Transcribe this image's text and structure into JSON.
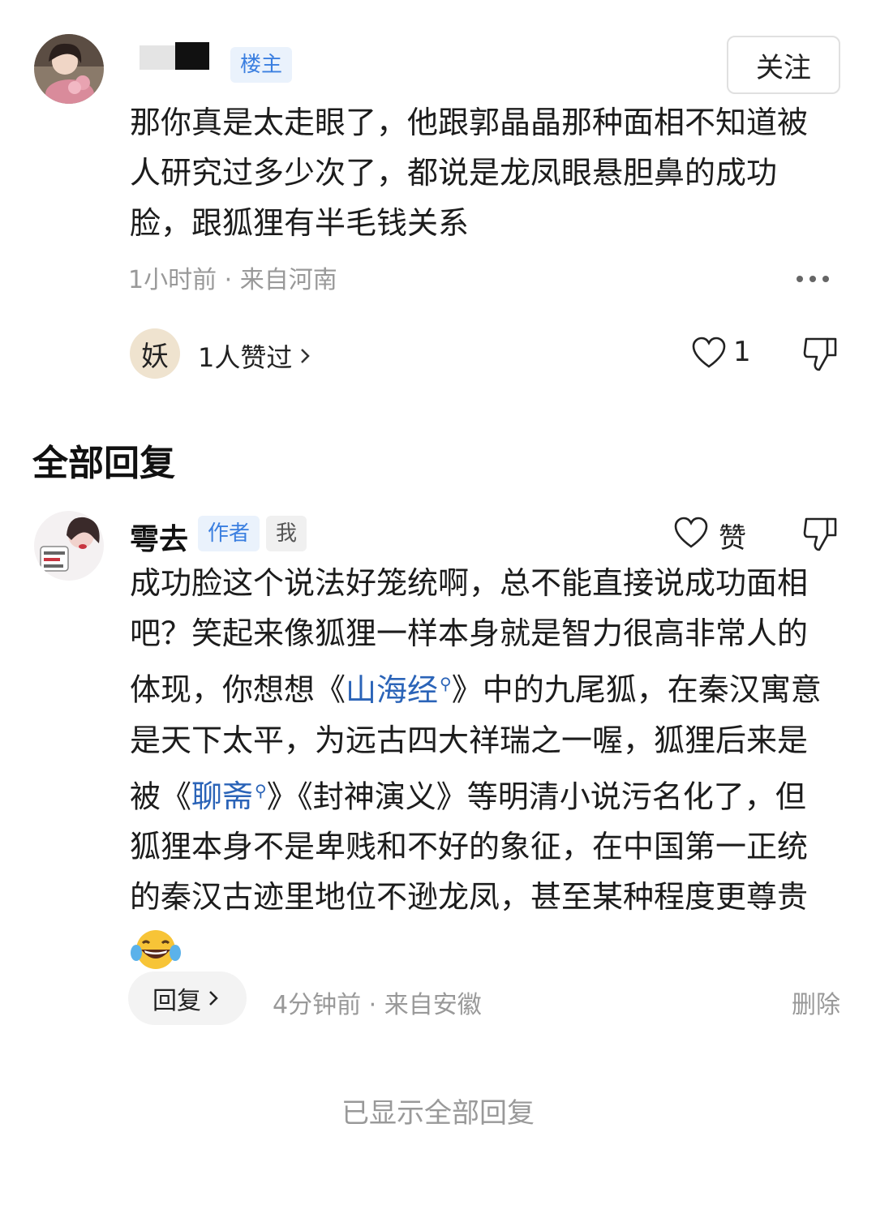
{
  "parent_comment": {
    "badge": "楼主",
    "follow_label": "关注",
    "content": "那你真是太走眼了，他跟郭晶晶那种面相不知道被人研究过多少次了，都说是龙凤眼悬胆鼻的成功脸，跟狐狸有半毛钱关系",
    "meta": "1小时前 · 来自河南",
    "liker_avatar_char": "妖",
    "likers_text": "1人赞过",
    "like_count": "1"
  },
  "section_title": "全部回复",
  "reply": {
    "username": "雩去",
    "badge_author": "作者",
    "badge_me": "我",
    "like_label": "赞",
    "content_parts": {
      "p1": "成功脸这个说法好笼统啊，总不能直接说成功面相吧？笑起来像狐狸一样本身就是智力很高非常人的体现，你想想《",
      "link1": "山海经",
      "p2": "》中的九尾狐，在秦汉寓意是天下太平，为远古四大祥瑞之一喔，狐狸后来是被《",
      "link2": "聊斋",
      "p3": "》《封神演义》等明清小说污名化了，但狐狸本身不是卑贱和不好的象征，在中国第一正统的秦汉古迹里地位不逊龙凤，甚至某种程度更尊贵"
    },
    "reply_label": "回复",
    "meta": "4分钟前 · 来自安徽",
    "delete_label": "删除"
  },
  "footer_text": "已显示全部回复",
  "colors": {
    "badge_blue": "#3b7fe0",
    "link_blue": "#2b64b8",
    "meta_gray": "#999999"
  },
  "icons": [
    "heart-outline-icon",
    "thumbs-down-icon",
    "chevron-right-icon",
    "more-dots-icon",
    "search-mini-icon",
    "laughing-tears-emoji"
  ]
}
